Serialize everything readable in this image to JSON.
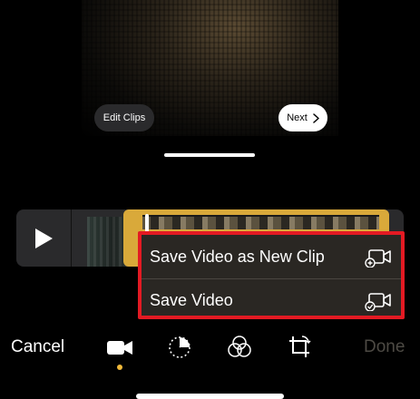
{
  "preview": {
    "edit_clips_label": "Edit Clips",
    "next_label": "Next"
  },
  "timeline": {
    "play_icon": "play-icon"
  },
  "menu": {
    "items": [
      {
        "label": "Save Video as New Clip",
        "icon": "video-plus-icon"
      },
      {
        "label": "Save Video",
        "icon": "video-check-icon"
      }
    ],
    "highlight_color": "#e31a23"
  },
  "toolbar": {
    "cancel_label": "Cancel",
    "done_label": "Done",
    "tools": [
      "video-camera-icon",
      "adjust-icon",
      "filters-icon",
      "crop-rotate-icon"
    ],
    "accent_color": "#f0b93a"
  }
}
